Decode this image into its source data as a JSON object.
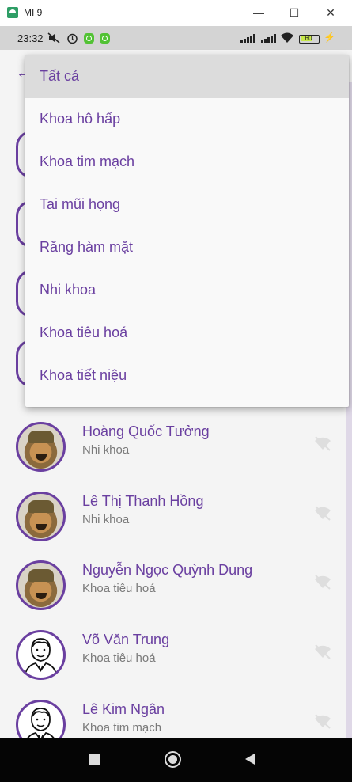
{
  "window": {
    "title": "MI 9",
    "minimize_glyph": "—",
    "maximize_glyph": "☐",
    "close_glyph": "✕"
  },
  "statusbar": {
    "time": "23:32",
    "battery": "60",
    "icons": [
      "mute-icon",
      "alarm-icon",
      "app-notification-icon",
      "app-notification-icon",
      "signal-icon",
      "signal-icon",
      "wifi-icon",
      "battery-icon",
      "charging-icon"
    ]
  },
  "dropdown": {
    "items": [
      {
        "label": "Tất cả",
        "selected": true
      },
      {
        "label": "Khoa hô hấp"
      },
      {
        "label": "Khoa tim mạch"
      },
      {
        "label": "Tai mũi họng"
      },
      {
        "label": "Răng hàm mặt"
      },
      {
        "label": "Nhi khoa"
      },
      {
        "label": "Khoa tiêu hoá"
      },
      {
        "label": "Khoa tiết niệu"
      }
    ]
  },
  "doctors": [
    {
      "name": "Hoàng Quốc Tưởng",
      "department": "Nhi khoa",
      "avatar": "photo",
      "status_icon": "wifi-off-icon"
    },
    {
      "name": "Lê Thị Thanh Hồng",
      "department": "Nhi khoa",
      "avatar": "photo",
      "status_icon": "wifi-off-icon"
    },
    {
      "name": "Nguyễn Ngọc Quỳnh Dung",
      "department": "Khoa tiêu hoá",
      "avatar": "photo",
      "status_icon": "wifi-off-icon"
    },
    {
      "name": "Võ Văn Trung",
      "department": "Khoa tiêu hoá",
      "avatar": "drawn",
      "status_icon": "wifi-off-icon"
    },
    {
      "name": "Lê Kim Ngân",
      "department": "Khoa tim mạch",
      "avatar": "drawn",
      "status_icon": "wifi-off-icon"
    }
  ],
  "colors": {
    "accent": "#6a3fa0",
    "secondary_text": "#7a7a7a",
    "selected_row": "#dcdcdc",
    "navbar": "#050505"
  }
}
